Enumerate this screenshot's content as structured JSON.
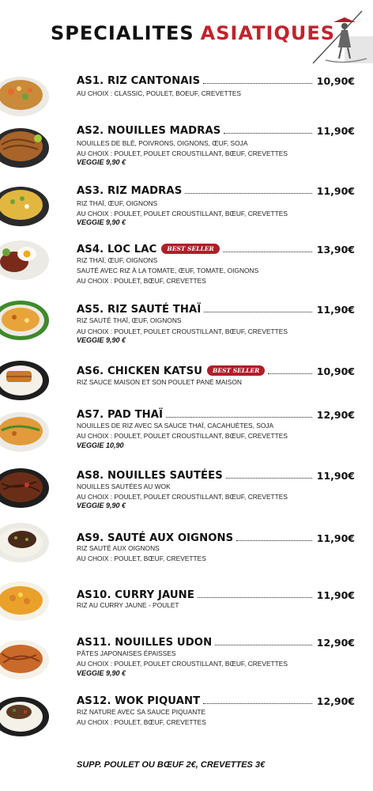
{
  "header": {
    "title_word1": "SPECIALITES",
    "title_word2": "ASIATIQUES"
  },
  "colors": {
    "accent": "#c0242c",
    "badge": "#b01e2a",
    "text": "#111111"
  },
  "items": [
    {
      "code_name": "AS1. RIZ CANTONAIS",
      "price": "10,90€",
      "badge": "",
      "desc": [
        "AU CHOIX : CLASSIC, POULET, BOEUF, CREVETTES"
      ],
      "veggie": "",
      "icon": "fried-rice-bowl-icon"
    },
    {
      "code_name": "AS2. NOUILLES MADRAS",
      "price": "11,90€",
      "badge": "",
      "desc": [
        "NOUILLES DE BLÉ, POIVRONS, OIGNONS, ŒUF, SOJA",
        "AU CHOIX : POULET, POULET CROUSTILLANT, BŒUF, CREVETTES"
      ],
      "veggie": "VEGGIE 9,90 €",
      "icon": "noodles-plate-icon"
    },
    {
      "code_name": "AS3. RIZ MADRAS",
      "price": "11,90€",
      "badge": "",
      "desc": [
        "RIZ THAÏ, ŒUF, OIGNONS",
        "AU CHOIX : POULET, POULET CROUSTILLANT, BŒUF, CREVETTES"
      ],
      "veggie": "VEGGIE 9,90 €",
      "icon": "yellow-rice-plate-icon"
    },
    {
      "code_name": "AS4. LOC LAC",
      "price": "13,90€",
      "badge": "BEST SELLER",
      "desc": [
        "RIZ THAÏ, ŒUF, OIGNONS",
        "SAUTÉ AVEC RIZ À LA TOMATE, ŒUF, TOMATE, OIGNONS",
        "AU CHOIX : POULET, BŒUF, CREVETTES"
      ],
      "veggie": "",
      "icon": "loc-lac-plate-icon"
    },
    {
      "code_name": "AS5. RIZ SAUTÉ THAÏ",
      "price": "11,90€",
      "badge": "",
      "desc": [
        "RIZ SAUTÉ THAÏ, ŒUF, OIGNONS",
        "AU CHOIX : POULET, POULET CROUSTILLANT, BŒUF, CREVETTES"
      ],
      "veggie": "VEGGIE 9,90 €",
      "icon": "thai-rice-plate-icon"
    },
    {
      "code_name": "AS6. CHICKEN KATSU",
      "price": "10,90€",
      "badge": "BEST SELLER",
      "desc": [
        "RIZ SAUCE MAISON ET SON POULET PANÉ MAISON"
      ],
      "veggie": "",
      "icon": "katsu-plate-icon"
    },
    {
      "code_name": "AS7. PAD THAÏ",
      "price": "12,90€",
      "badge": "",
      "desc": [
        "NOUILLES DE RIZ AVEC SA SAUCE THAÏ, CACAHUÈTES, SOJA",
        "AU CHOIX : POULET, POULET CROUSTILLANT, BŒUF, CREVETTES"
      ],
      "veggie": "VEGGIE 10,90",
      "icon": "pad-thai-plate-icon"
    },
    {
      "code_name": "AS8. NOUILLES SAUTÉES",
      "price": "11,90€",
      "badge": "",
      "desc": [
        "NOUILLES SAUTÉES AU WOK",
        "AU CHOIX : POULET, POULET CROUSTILLANT, BŒUF, CREVETTES"
      ],
      "veggie": "VEGGIE 9,90 €",
      "icon": "wok-noodles-icon"
    },
    {
      "code_name": "AS9. SAUTÉ AUX OIGNONS",
      "price": "11,90€",
      "badge": "",
      "desc": [
        "RIZ SAUTÉ AUX OIGNONS",
        "AU CHOIX : POULET, BŒUF, CREVETTES"
      ],
      "veggie": "",
      "icon": "onion-saute-plate-icon"
    },
    {
      "code_name": "AS10. CURRY JAUNE",
      "price": "11,90€",
      "badge": "",
      "desc": [
        "RIZ AU CURRY JAUNE - POULET"
      ],
      "veggie": "",
      "icon": "yellow-curry-bowl-icon"
    },
    {
      "code_name": "AS11. NOUILLES UDON",
      "price": "12,90€",
      "badge": "",
      "desc": [
        "PÂTES JAPONAISES ÉPAISSES",
        "AU CHOIX : POULET, POULET CROUSTILLANT, BŒUF, CREVETTES"
      ],
      "veggie": "VEGGIE 9,90 €",
      "icon": "udon-plate-icon"
    },
    {
      "code_name": "AS12. WOK PIQUANT",
      "price": "12,90€",
      "badge": "",
      "desc": [
        "RIZ NATURE AVEC SA SAUCE PIQUANTE",
        "AU CHOIX : POULET, BŒUF, CREVETTES"
      ],
      "veggie": "",
      "icon": "spicy-wok-plate-icon"
    }
  ],
  "footer": {
    "text": "SUPP. POULET OU BŒUF 2€, CREVETTES 3€"
  }
}
